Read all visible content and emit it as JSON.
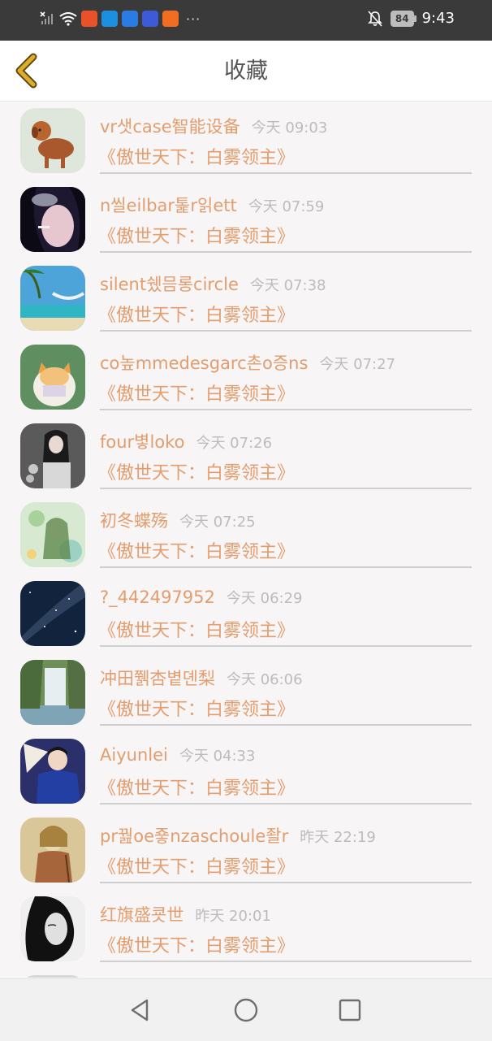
{
  "status_bar": {
    "time": "9:43",
    "battery": "84",
    "more": "···",
    "app_colors": [
      "#e8512a",
      "#1d8fe0",
      "#2a7be3",
      "#3d5bd9",
      "#f16d22"
    ]
  },
  "header": {
    "title": "收藏",
    "back_icon": "back-chevron-icon",
    "accent": "#e0ad2a"
  },
  "list": {
    "text_color": "#e39d6e",
    "time_color": "#bcbcbc",
    "items": [
      {
        "name": "vr샛case智能设备",
        "time": "今天 09:03",
        "book": "《傲世天下：白雾领主》",
        "avatar": "dog-avatar"
      },
      {
        "name": "n씰eilbar톭r읽ett",
        "time": "今天 07:59",
        "book": "《傲世天下：白雾领主》",
        "avatar": "smoking-woman-avatar"
      },
      {
        "name": "silent쉤믐롱circle",
        "time": "今天 07:38",
        "book": "《傲世天下：白雾领主》",
        "avatar": "beach-hammock-avatar"
      },
      {
        "name": "co높mmedesgarc촌o증ns",
        "time": "今天 07:27",
        "book": "《傲世天下：白雾领主》",
        "avatar": "cat-avatar"
      },
      {
        "name": "four볗loko",
        "time": "今天 07:26",
        "book": "《傲世天下：白雾领主》",
        "avatar": "girl-flowers-avatar"
      },
      {
        "name": "初冬蝶殇",
        "time": "今天 07:25",
        "book": "《傲世天下：白雾领主》",
        "avatar": "anime-girl-avatar"
      },
      {
        "name": "?_442497952",
        "time": "今天 06:29",
        "book": "《傲世天下：白雾领主》",
        "avatar": "night-sky-avatar"
      },
      {
        "name": "冲田쮉杏볕뎬梨",
        "time": "今天 06:06",
        "book": "《傲世天下：白雾领主》",
        "avatar": "waterfall-avatar"
      },
      {
        "name": "Aiyunlei",
        "time": "今天 04:33",
        "book": "《傲世天下：白雾领主》",
        "avatar": "man-with-fan-avatar"
      },
      {
        "name": "pr꿢oe죻nzaschoule좔r",
        "time": "昨天 22:19",
        "book": "《傲世天下：白雾领主》",
        "avatar": "painting-avatar"
      },
      {
        "name": "红旗盛쿗世",
        "time": "昨天 20:01",
        "book": "《傲世天下：白雾领主》",
        "avatar": "bw-portrait-avatar"
      }
    ]
  },
  "nav_bar": {
    "back": "nav-back-icon",
    "home": "nav-home-icon",
    "recents": "nav-recents-icon"
  }
}
